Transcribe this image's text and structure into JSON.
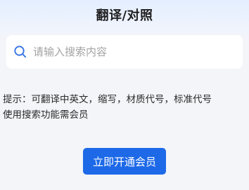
{
  "header": {
    "title": "翻译/对照"
  },
  "search": {
    "icon": "search-icon",
    "placeholder": "请输入搜索内容",
    "value": ""
  },
  "tip": {
    "line1": "提示：可翻译中英文，缩写，材质代号，标准代号",
    "line2": "使用搜索功能需会员"
  },
  "action": {
    "vip_label": "立即开通会员"
  },
  "colors": {
    "accent": "#1D69E8",
    "background": "#F4F5F9",
    "header_tint": "#E3EEFF",
    "search_icon": "#2F6FE4"
  }
}
